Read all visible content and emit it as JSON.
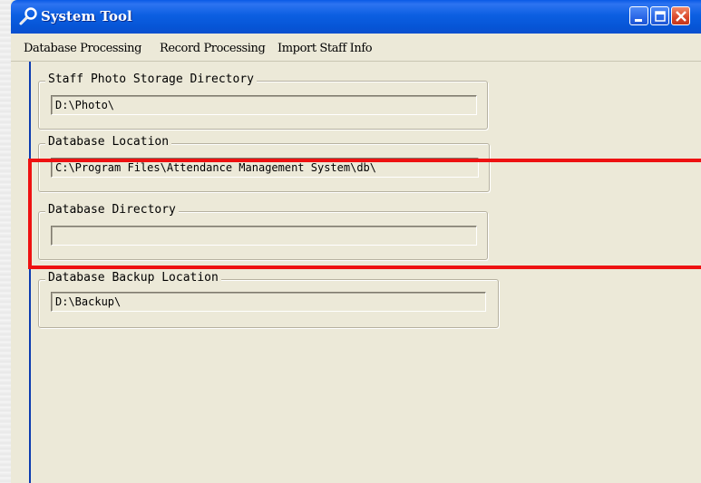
{
  "window": {
    "title": "System Tool"
  },
  "menu": {
    "items": [
      {
        "label": "Database Processing"
      },
      {
        "label": "Record Processing"
      },
      {
        "label": "Import Staff Info"
      }
    ]
  },
  "groups": {
    "photo_dir": {
      "label": "Staff Photo Storage Directory",
      "value": "D:\\Photo\\"
    },
    "db_location": {
      "label": "Database Location",
      "value": "C:\\Program Files\\Attendance Management System\\db\\"
    },
    "db_directory": {
      "label": "Database Directory",
      "value": ""
    },
    "backup_location": {
      "label": "Database Backup Location",
      "value": "D:\\Backup\\"
    }
  },
  "colors": {
    "titlebar": "#0a5ae6",
    "highlight": "#ee1111",
    "window_bg": "#ece9d8"
  }
}
